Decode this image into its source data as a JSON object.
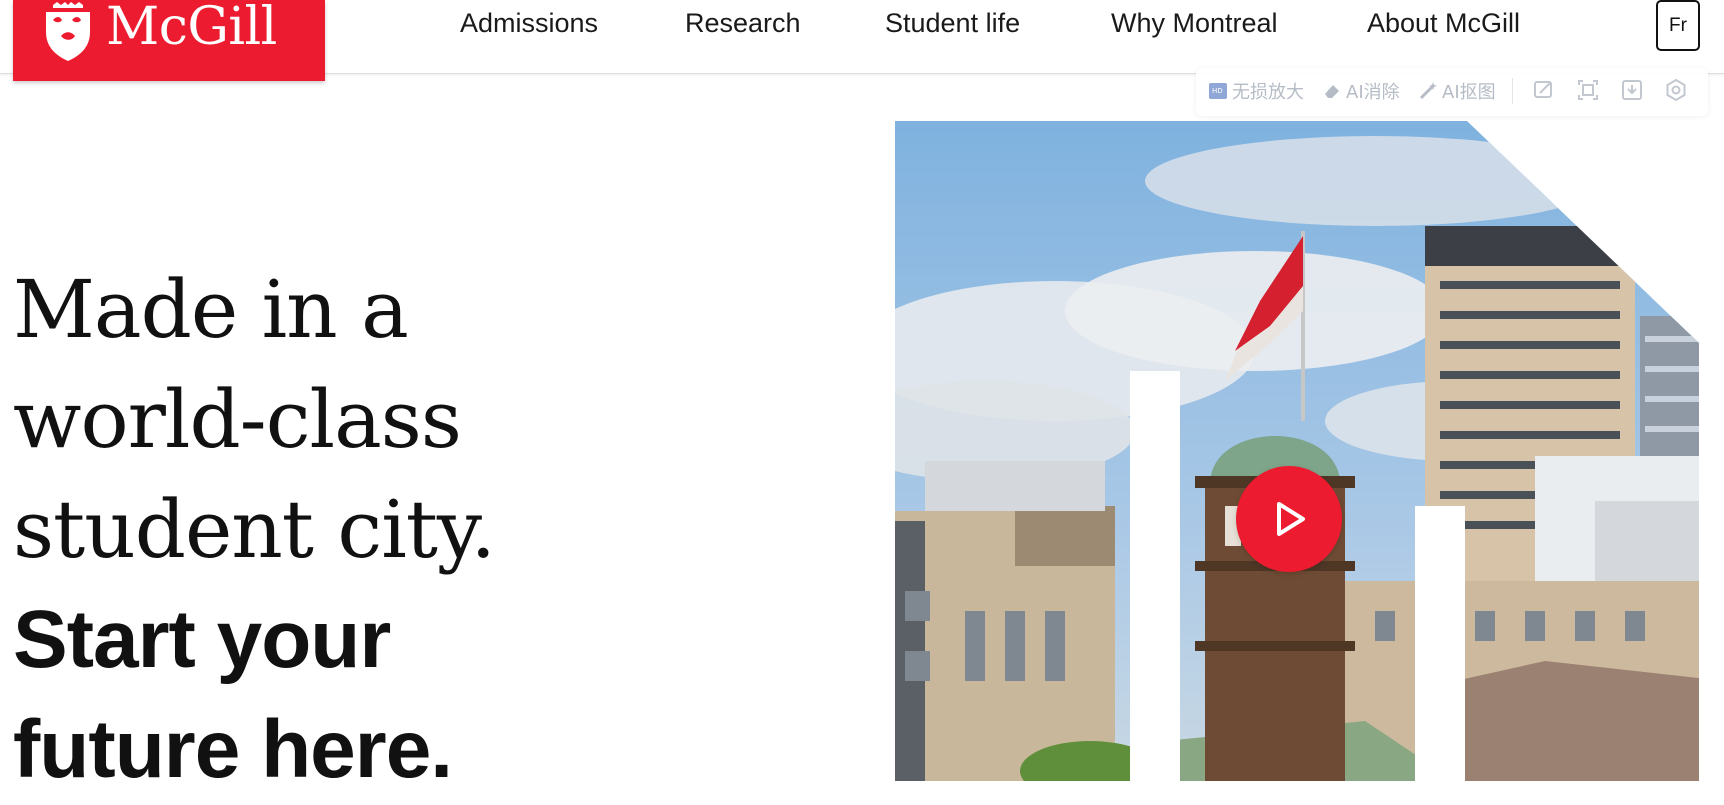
{
  "header": {
    "logo_text": "McGill",
    "nav": [
      {
        "label": "Admissions"
      },
      {
        "label": "Research"
      },
      {
        "label": "Student life"
      },
      {
        "label": "Why Montreal"
      },
      {
        "label": "About McGill"
      }
    ],
    "language_button": "Fr"
  },
  "ai_toolbar": {
    "tools": [
      {
        "label": "无损放大",
        "icon": "hd-upscale-icon"
      },
      {
        "label": "AI消除",
        "icon": "eraser-icon"
      },
      {
        "label": "AI抠图",
        "icon": "magic-wand-icon"
      }
    ],
    "icon_buttons": [
      "edit-image-icon",
      "crop-frame-icon",
      "download-icon",
      "settings-icon"
    ]
  },
  "hero": {
    "headline_serif": [
      "Made in a",
      "world-class",
      "student city."
    ],
    "headline_sans": [
      "Start your",
      "future here."
    ],
    "play_button_icon": "play-icon"
  },
  "colors": {
    "brand_red": "#ed1b2f",
    "text": "#111111",
    "toolbar_gray": "#b6bcc6"
  }
}
